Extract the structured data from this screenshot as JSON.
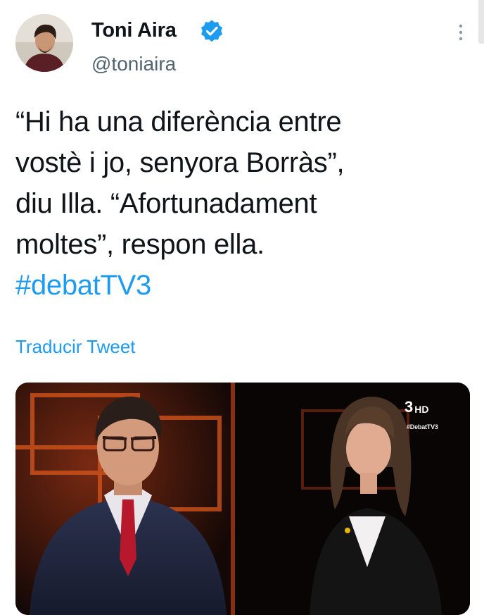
{
  "author": {
    "display_name": "Toni Aira",
    "handle": "@toniaira",
    "verified": true
  },
  "tweet": {
    "lines": [
      "“Hi ha una diferència entre",
      "vostè i jo, senyora Borràs”,",
      "diu Illa. “Afortunadament",
      "moltes”, respon ella."
    ],
    "hashtag": "#debatTV3",
    "translate_label": "Traducir Tweet"
  },
  "media": {
    "channel_logo": "3",
    "channel_quality": "HD",
    "broadcast_hashtag": "#DebatTV3"
  },
  "icons": {
    "verified": "verified-badge-icon",
    "more": "more-vertical-icon"
  },
  "colors": {
    "link": "#1d9bf0",
    "secondary_text": "#536471",
    "primary_text": "#0f1419"
  }
}
